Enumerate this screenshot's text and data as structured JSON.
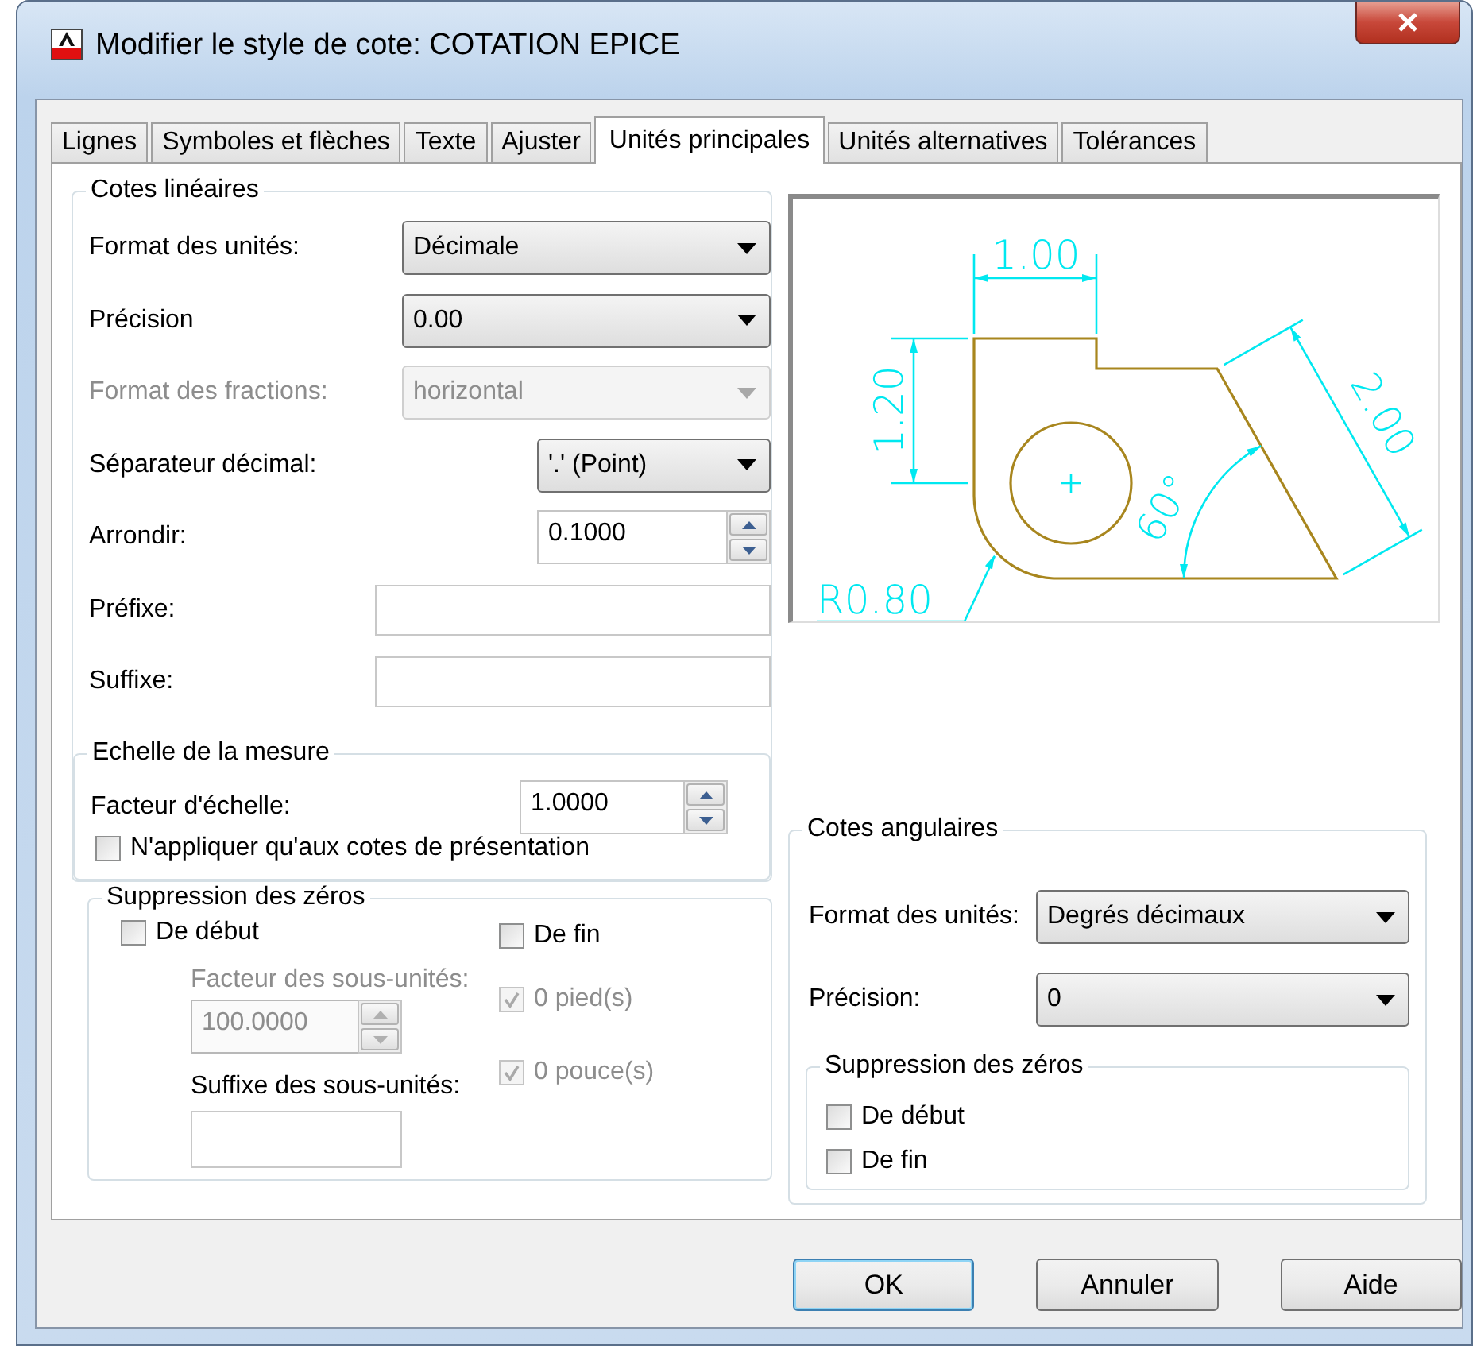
{
  "window": {
    "title": "Modifier le style de cote: COTATION EPICE"
  },
  "tabs": [
    {
      "label": "Lignes",
      "selected": false
    },
    {
      "label": "Symboles et flèches",
      "selected": false
    },
    {
      "label": "Texte",
      "selected": false
    },
    {
      "label": "Ajuster",
      "selected": false
    },
    {
      "label": "Unités principales",
      "selected": true
    },
    {
      "label": "Unités alternatives",
      "selected": false
    },
    {
      "label": "Tolérances",
      "selected": false
    }
  ],
  "linear_dimensions": {
    "title": "Cotes linéaires",
    "fields": [
      {
        "kind": "combo",
        "label": "Format des unités:",
        "value": "Décimale",
        "disabled": false
      },
      {
        "kind": "combo",
        "label": "Précision",
        "value": "0.00",
        "disabled": false
      },
      {
        "kind": "combo",
        "label": "Format des fractions:",
        "value": "horizontal",
        "disabled": true
      },
      {
        "kind": "short-combo",
        "label": "Séparateur décimal:",
        "value": "'.' (Point)",
        "disabled": false
      },
      {
        "kind": "spin",
        "label": "Arrondir:",
        "value": "0.1000",
        "disabled": false
      },
      {
        "kind": "text",
        "label": "Préfixe:"
      },
      {
        "kind": "text",
        "label": "Suffixe:"
      }
    ],
    "scale": {
      "title": "Echelle de la mesure",
      "factor": {
        "label": "Facteur d'échelle:",
        "value": "1.0000",
        "disabled": false
      },
      "layout_only": {
        "label": "N'appliquer qu'aux cotes de présentation",
        "checked": false,
        "disabled": false
      }
    }
  },
  "zero_suppression": {
    "title": "Suppression des zéros",
    "leading": {
      "label": "De début",
      "checked": false,
      "disabled": false
    },
    "sub_units_factor": {
      "label": "Facteur des sous-unités:",
      "value": "100.0000",
      "disabled": true
    },
    "sub_units_suffix": {
      "label": "Suffixe des sous-unités:"
    },
    "trailing": {
      "label": "De fin",
      "checked": false,
      "disabled": false
    },
    "feet": {
      "label": "0 pied(s)",
      "checked": true,
      "disabled": true
    },
    "inches": {
      "label": "0 pouce(s)",
      "checked": true,
      "disabled": true
    }
  },
  "preview": {
    "top_dimension": "1.00",
    "left_dimension": "1.20",
    "edge_dimension": "2.00",
    "angle_dimension": "60°",
    "radius_dimension": "R0.80"
  },
  "angular_dimensions": {
    "title": "Cotes angulaires",
    "format": {
      "label": "Format des unités:",
      "value": "Degrés décimaux",
      "disabled": false
    },
    "precision": {
      "label": "Précision:",
      "value": "0",
      "disabled": false
    },
    "zero_suppression": {
      "title": "Suppression des zéros",
      "items": [
        {
          "label": "De début",
          "checked": false,
          "disabled": false
        },
        {
          "label": "De fin",
          "checked": false,
          "disabled": false
        }
      ]
    }
  },
  "buttons": [
    {
      "label": "OK",
      "default": true
    },
    {
      "label": "Annuler",
      "default": false
    },
    {
      "label": "Aide",
      "default": false
    }
  ]
}
